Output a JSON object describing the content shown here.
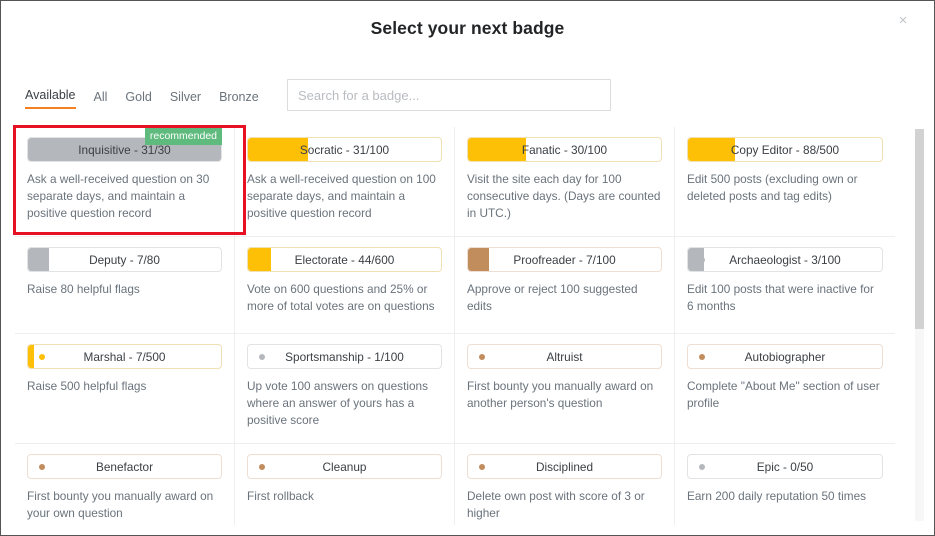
{
  "modal": {
    "title": "Select your next badge",
    "close_icon": "close-icon",
    "close_glyph": "×"
  },
  "filters": {
    "tabs": [
      {
        "label": "Available",
        "active": true
      },
      {
        "label": "All",
        "active": false
      },
      {
        "label": "Gold",
        "active": false
      },
      {
        "label": "Silver",
        "active": false
      },
      {
        "label": "Bronze",
        "active": false
      }
    ],
    "active_tab": "Available",
    "active_underline_color": "#f48024"
  },
  "search": {
    "placeholder": "Search for a badge...",
    "value": ""
  },
  "colors": {
    "gold": "#fdc006",
    "silver": "#b4b8bc",
    "bronze": "#c18d5d",
    "recommended_badge": "#5eba7d",
    "highlight_box": "#e81123",
    "accent": "#f48024"
  },
  "recommended_label": "recommended",
  "badges": [
    {
      "name": "Inquisitive - 31/30",
      "tier": "silver",
      "fill_percent": 100,
      "dot": false,
      "description": "Ask a well-received question on 30 separate days, and maintain a positive question record",
      "recommended": true,
      "highlighted": true
    },
    {
      "name": "Socratic - 31/100",
      "tier": "gold",
      "fill_percent": 31,
      "dot": false,
      "description": "Ask a well-received question on 100 separate days, and maintain a positive question record",
      "recommended": false,
      "highlighted": false
    },
    {
      "name": "Fanatic - 30/100",
      "tier": "gold",
      "fill_percent": 30,
      "dot": false,
      "description": "Visit the site each day for 100 consecutive days. (Days are counted in UTC.)",
      "recommended": false,
      "highlighted": false
    },
    {
      "name": "Copy Editor - 88/500",
      "tier": "gold",
      "fill_percent": 24,
      "dot": false,
      "description": "Edit 500 posts (excluding own or deleted posts and tag edits)",
      "recommended": false,
      "highlighted": false
    },
    {
      "name": "Deputy - 7/80",
      "tier": "silver",
      "fill_percent": 11,
      "dot": false,
      "description": "Raise 80 helpful flags",
      "recommended": false,
      "highlighted": false
    },
    {
      "name": "Electorate - 44/600",
      "tier": "gold",
      "fill_percent": 12,
      "dot": true,
      "description": "Vote on 600 questions and 25% or more of total votes are on questions",
      "recommended": false,
      "highlighted": false
    },
    {
      "name": "Proofreader - 7/100",
      "tier": "bronze",
      "fill_percent": 11,
      "dot": false,
      "description": "Approve or reject 100 suggested edits",
      "recommended": false,
      "highlighted": false
    },
    {
      "name": "Archaeologist - 3/100",
      "tier": "silver",
      "fill_percent": 8,
      "dot": true,
      "description": "Edit 100 posts that were inactive for 6 months",
      "recommended": false,
      "highlighted": false
    },
    {
      "name": "Marshal - 7/500",
      "tier": "gold",
      "fill_percent": 3,
      "dot": true,
      "description": "Raise 500 helpful flags",
      "recommended": false,
      "highlighted": false
    },
    {
      "name": "Sportsmanship - 1/100",
      "tier": "silver",
      "fill_percent": 0,
      "dot": true,
      "description": "Up vote 100 answers on questions where an answer of yours has a positive score",
      "recommended": false,
      "highlighted": false
    },
    {
      "name": "Altruist",
      "tier": "bronze",
      "fill_percent": 0,
      "dot": true,
      "description": "First bounty you manually award on another person's question",
      "recommended": false,
      "highlighted": false
    },
    {
      "name": "Autobiographer",
      "tier": "bronze",
      "fill_percent": 0,
      "dot": true,
      "description": "Complete \"About Me\" section of user profile",
      "recommended": false,
      "highlighted": false
    },
    {
      "name": "Benefactor",
      "tier": "bronze",
      "fill_percent": 0,
      "dot": true,
      "description": "First bounty you manually award on your own question",
      "recommended": false,
      "highlighted": false
    },
    {
      "name": "Cleanup",
      "tier": "bronze",
      "fill_percent": 0,
      "dot": true,
      "description": "First rollback",
      "recommended": false,
      "highlighted": false
    },
    {
      "name": "Disciplined",
      "tier": "bronze",
      "fill_percent": 0,
      "dot": true,
      "description": "Delete own post with score of 3 or higher",
      "recommended": false,
      "highlighted": false
    },
    {
      "name": "Epic - 0/50",
      "tier": "silver",
      "fill_percent": 0,
      "dot": true,
      "description": "Earn 200 daily reputation 50 times",
      "recommended": false,
      "highlighted": false
    }
  ],
  "scrollbar": {
    "thumb_position_percent": 0,
    "thumb_size_percent": 51
  }
}
